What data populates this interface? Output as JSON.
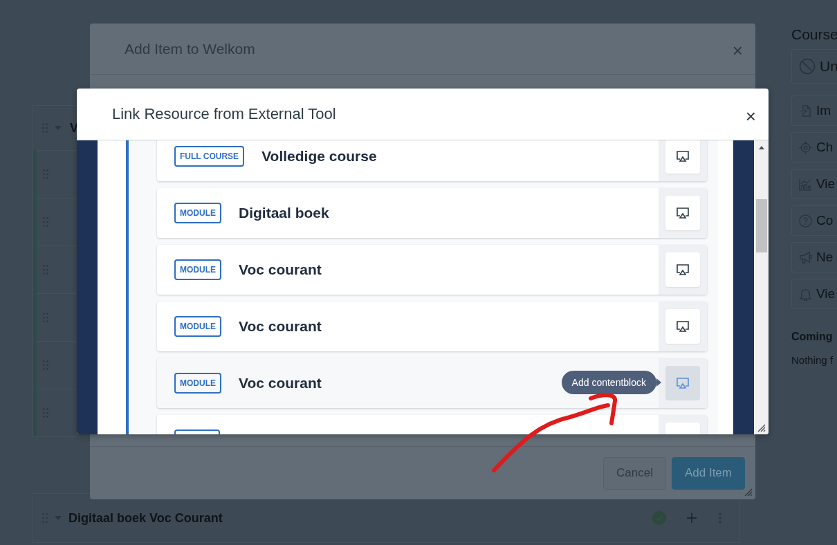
{
  "background_page": {
    "module_title": "V",
    "module_below": {
      "title": "Digitaal boek Voc Courant",
      "published": true
    }
  },
  "sidebar": {
    "heading": "Course",
    "buttons": [
      {
        "label": "Un",
        "kind": "unpublish"
      },
      {
        "label": "Im",
        "kind": "import"
      },
      {
        "label": "Ch",
        "kind": "target"
      },
      {
        "label": "Vie",
        "kind": "stats"
      },
      {
        "label": "Co",
        "kind": "help"
      },
      {
        "label": "Ne",
        "kind": "announce"
      },
      {
        "label": "Vie",
        "kind": "bell"
      }
    ],
    "coming_heading": "Coming",
    "coming_text": "Nothing f"
  },
  "add_item_dialog": {
    "title": "Add Item to Welkom",
    "close": "×",
    "buttons": [
      {
        "label": "Cancel",
        "kind": "secondary"
      },
      {
        "label": "Add Item",
        "kind": "primary"
      }
    ]
  },
  "link_resource_dialog": {
    "title": "Link Resource from External Tool",
    "close": "×",
    "tooltip": "Add contentblock",
    "items": [
      {
        "badge": "FULL COURSE",
        "title": "Volledige course",
        "hovered": false
      },
      {
        "badge": "MODULE",
        "title": "Digitaal boek",
        "hovered": false
      },
      {
        "badge": "MODULE",
        "title": "Voc courant",
        "hovered": false
      },
      {
        "badge": "MODULE",
        "title": "Voc courant",
        "hovered": false
      },
      {
        "badge": "MODULE",
        "title": "Voc courant",
        "hovered": true
      }
    ]
  }
}
